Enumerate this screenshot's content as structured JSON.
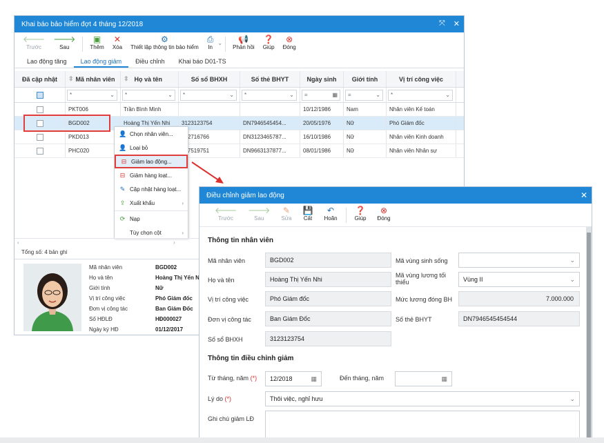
{
  "main_window": {
    "title": "Khai báo bảo hiểm đợt 4 tháng 12/2018",
    "toolbar": [
      {
        "label": "Trước",
        "icon": "arrow-left-icon",
        "disabled": true
      },
      {
        "label": "Sau",
        "icon": "arrow-right-icon",
        "disabled": false
      },
      {
        "label": "Thêm",
        "icon": "add-document-icon",
        "disabled": false
      },
      {
        "label": "Xóa",
        "icon": "delete-x-icon",
        "disabled": false
      },
      {
        "label": "Thiết lập thông tin bảo hiểm",
        "icon": "gear-icon",
        "disabled": false
      },
      {
        "label": "In",
        "icon": "printer-icon",
        "disabled": false
      },
      {
        "label": "Phản hồi",
        "icon": "megaphone-icon",
        "disabled": false
      },
      {
        "label": "Giúp",
        "icon": "help-icon",
        "disabled": false
      },
      {
        "label": "Đóng",
        "icon": "close-circle-icon",
        "disabled": false
      }
    ],
    "tabs": [
      "Lao động tăng",
      "Lao động giảm",
      "Điều chỉnh",
      "Khai báo D01-TS"
    ],
    "active_tab": "Lao động giảm",
    "grid": {
      "columns": [
        "Đã cập nhật",
        "Mã nhân viên",
        "Họ và tên",
        "Số sổ BHXH",
        "Số thẻ BHYT",
        "Ngày sinh",
        "Giới tính",
        "Vị trí công việc"
      ],
      "filters": [
        "*",
        "*",
        "*",
        "*",
        "=",
        "=",
        "*"
      ],
      "rows": [
        {
          "code": "PKT006",
          "name": "Trần Bình Minh",
          "bhxh": "",
          "bhyt": "",
          "dob": "10/12/1986",
          "gender": "Nam",
          "position": "Nhân viên Kế toán"
        },
        {
          "code": "BGD002",
          "name": "Hoàng Thị Yến Nhi",
          "bhxh": "3123123754",
          "bhyt": "DN7946545454...",
          "dob": "20/05/1976",
          "gender": "Nữ",
          "position": "Phó Giám đốc"
        },
        {
          "code": "PKD013",
          "name": "",
          "bhxh": "432716766",
          "bhyt": "DN3123465787...",
          "dob": "16/10/1986",
          "gender": "Nữ",
          "position": "Nhân viên Kinh doanh"
        },
        {
          "code": "PHC020",
          "name": "",
          "bhxh": "697519751",
          "bhyt": "DN9663137877...",
          "dob": "08/01/1986",
          "gender": "Nữ",
          "position": "Nhân viên Nhân sự"
        }
      ]
    },
    "context_menu": [
      {
        "label": "Chọn nhân viên...",
        "icon": "add-person-icon"
      },
      {
        "label": "Loại bỏ",
        "icon": "remove-person-icon"
      },
      {
        "label": "Giảm lao động...",
        "icon": "decrease-icon",
        "highlighted": true
      },
      {
        "label": "Giảm hàng loạt...",
        "icon": "decrease-batch-icon"
      },
      {
        "label": "Cập nhật hàng loạt...",
        "icon": "edit-batch-icon"
      },
      {
        "label": "Xuất khẩu",
        "icon": "export-icon",
        "submenu": true
      },
      {
        "label": "Nạp",
        "icon": "refresh-icon"
      },
      {
        "label": "Tùy chọn cột",
        "icon": "",
        "submenu": true
      }
    ],
    "summary": "Tổng số: 4 bản ghi",
    "detail": [
      {
        "label": "Mã nhân viên",
        "value": "BGD002"
      },
      {
        "label": "Họ và tên",
        "value": "Hoàng Thị Yến Nhi"
      },
      {
        "label": "Giới tính",
        "value": "Nữ"
      },
      {
        "label": "Vị trí công việc",
        "value": "Phó Giám đốc"
      },
      {
        "label": "Đơn vị công tác",
        "value": "Ban Giám Đốc"
      },
      {
        "label": "Số HĐLĐ",
        "value": "HĐ000027"
      },
      {
        "label": "Ngày ký HĐ",
        "value": "01/12/2017"
      }
    ]
  },
  "dialog": {
    "title": "Điều chỉnh giảm lao động",
    "toolbar": [
      {
        "label": "Trước",
        "icon": "arrow-left-icon",
        "disabled": true
      },
      {
        "label": "Sau",
        "icon": "arrow-right-icon",
        "disabled": true
      },
      {
        "label": "Sửa",
        "icon": "edit-icon",
        "disabled": true
      },
      {
        "label": "Cất",
        "icon": "save-icon",
        "disabled": false
      },
      {
        "label": "Hoãn",
        "icon": "undo-icon",
        "disabled": false
      },
      {
        "label": "Giúp",
        "icon": "help-icon",
        "disabled": false
      },
      {
        "label": "Đóng",
        "icon": "close-circle-icon",
        "disabled": false
      }
    ],
    "section_employee": "Thông tin nhân viên",
    "employee": {
      "ma_nv_label": "Mã nhân viên",
      "ma_nv": "BGD002",
      "ho_ten_label": "Họ và tên",
      "ho_ten": "Hoàng Thị Yến Nhi",
      "vi_tri_label": "Vị trí công việc",
      "vi_tri": "Phó Giám đốc",
      "don_vi_label": "Đơn vị công tác",
      "don_vi": "Ban Giám Đốc",
      "so_bhxh_label": "Số sổ BHXH",
      "so_bhxh": "3123123754",
      "vung_song_label": "Mã vùng sinh sống",
      "vung_song": "",
      "vung_luong_label": "Mã vùng lương tối thiểu",
      "vung_luong": "Vùng II",
      "muc_luong_label": "Mức lương đóng BH",
      "muc_luong": "7.000.000",
      "so_the_label": "Số thẻ BHYT",
      "so_the": "DN7946545454544"
    },
    "section_adjust": "Thông tin điều chỉnh giảm",
    "adjust": {
      "tu_thang_label": "Từ tháng, năm",
      "tu_thang": "12/2018",
      "den_thang_label": "Đến tháng, năm",
      "den_thang": "",
      "ly_do_label": "Lý do",
      "ly_do": "Thôi việc, nghỉ hưu",
      "ghi_chu_label": "Ghi chú giảm LĐ",
      "required_mark": "(*)"
    }
  }
}
